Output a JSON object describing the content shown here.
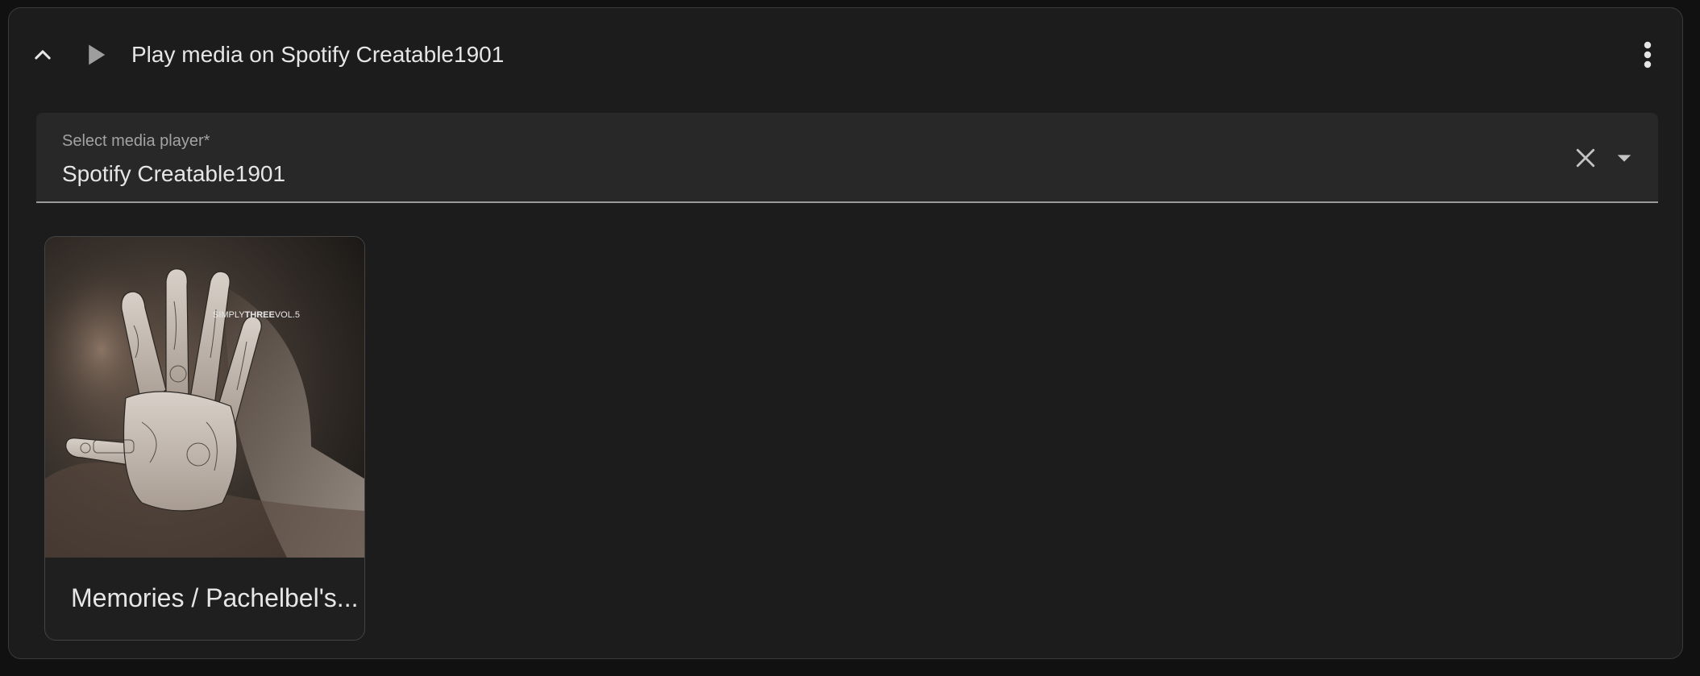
{
  "header": {
    "title": "Play media on Spotify Creatable1901",
    "collapse_icon": "chevron-up-icon",
    "action_icon": "play-icon",
    "menu_icon": "more-vertical-icon"
  },
  "media_player_select": {
    "label": "Select media player*",
    "value": "Spotify Creatable1901",
    "clear_icon": "close-icon",
    "dropdown_icon": "caret-down-icon"
  },
  "media_items": [
    {
      "title": "Memories / Pachelbel's...",
      "art_text": "SIMPLYTHREEVOL.5",
      "art_text_parts": [
        "SIMPLY",
        "THREE",
        "VOL.5"
      ]
    }
  ],
  "colors": {
    "page_background": "#111111",
    "card_background": "#1c1c1c",
    "field_background": "#282828",
    "text_primary": "#e6e6e6",
    "text_secondary": "#a3a3a3"
  }
}
